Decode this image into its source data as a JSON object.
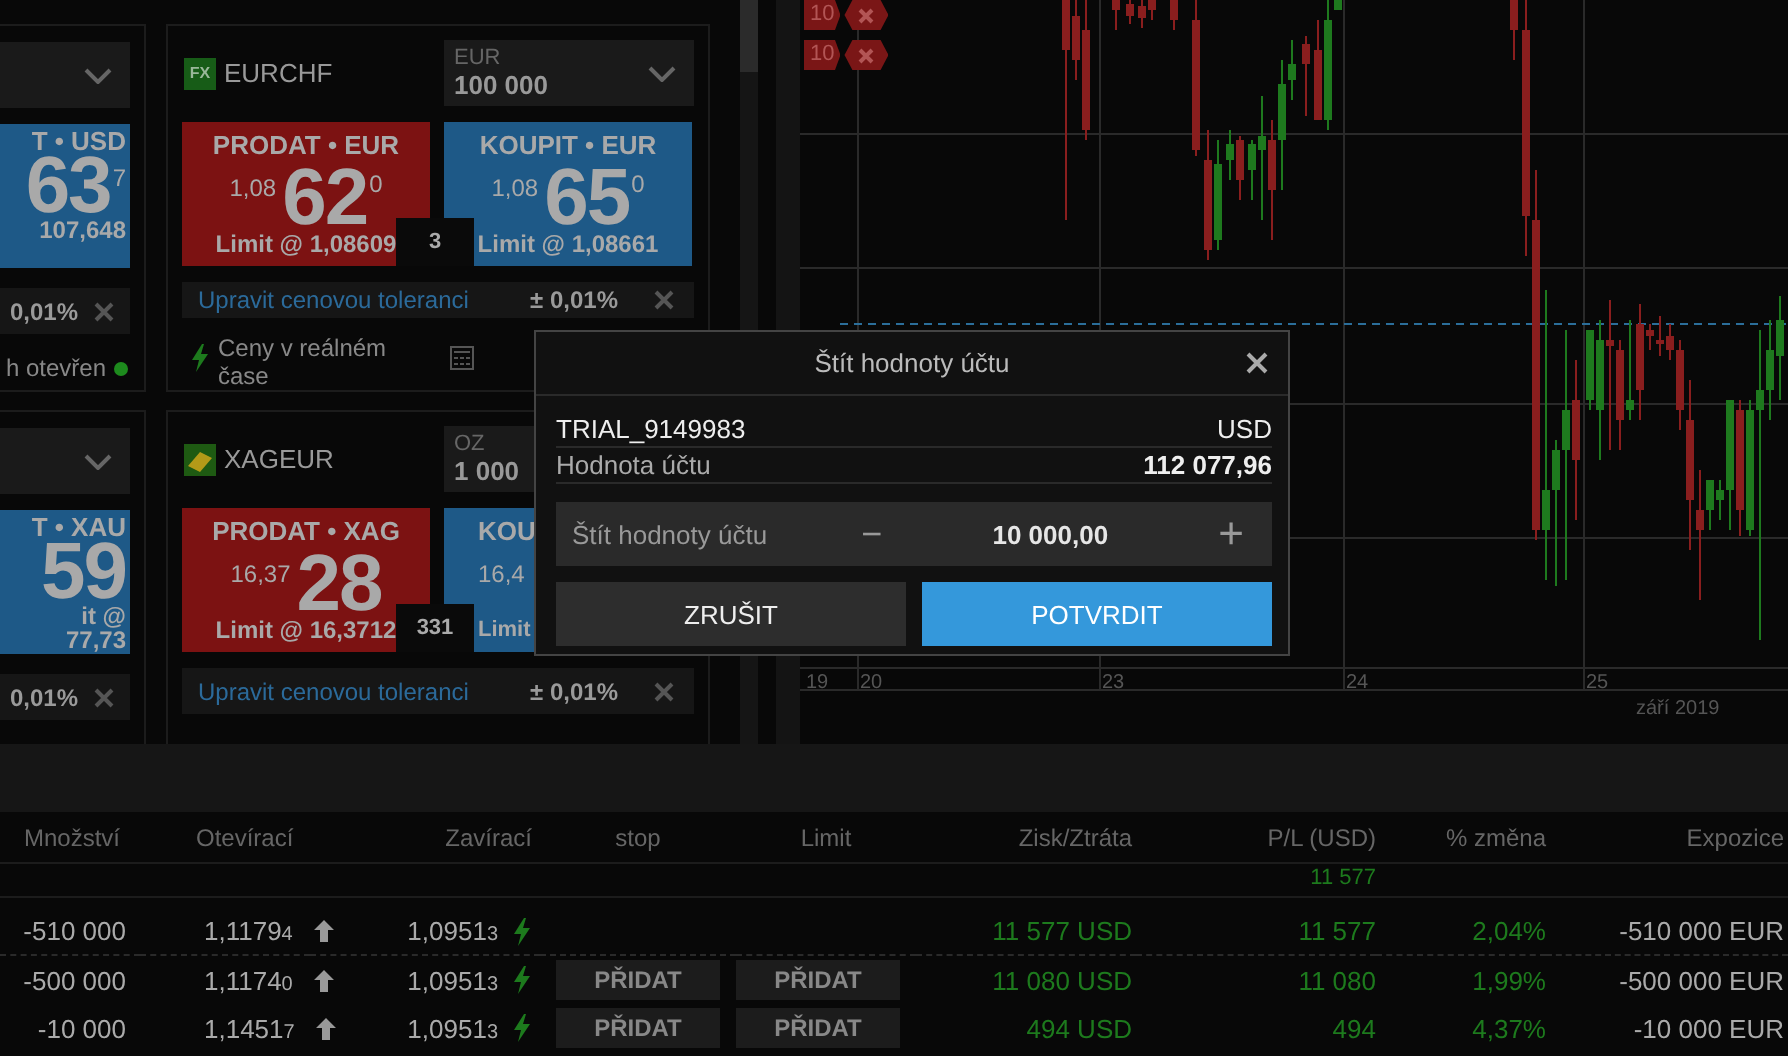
{
  "tile_rows": [
    {
      "partial": {
        "buy": {
          "label": "T • USD",
          "big": "63",
          "sup": "7",
          "limit_lines": [
            "107,648"
          ]
        },
        "tolerance": "0,01%",
        "status": {
          "text": "h otevřen",
          "open": true
        }
      },
      "full": {
        "symbol": "EURCHF",
        "badge": {
          "kind": "fx",
          "text": "FX"
        },
        "unit": "EUR",
        "amount": "100 000",
        "clipped": false,
        "sell": {
          "label": "PRODAT • EUR",
          "small": "1,08",
          "big": "62",
          "sup": "0",
          "limit": "Limit @ 1,08609"
        },
        "spread": "3",
        "buy": {
          "label": "KOUPIT • EUR",
          "small": "1,08",
          "big": "65",
          "sup": "0",
          "limit": "Limit @ 1,08661"
        },
        "tolerance_link": "Upravit cenovou toleranci",
        "tolerance": "± 0,01%",
        "footer": "Ceny v reálném čase"
      }
    },
    {
      "partial": {
        "buy": {
          "label": "T • XAU",
          "big": "59",
          "limit_lines": [
            "it @",
            "77,73"
          ]
        },
        "tolerance": "0,01%"
      },
      "full": {
        "symbol": "XAGEUR",
        "badge": {
          "kind": "metal"
        },
        "unit": "OZ",
        "amount": "1 000",
        "clipped": true,
        "sell": {
          "label": "PRODAT • XAG",
          "small": "16,37",
          "big": "28",
          "limit": "Limit @ 16,3712"
        },
        "spread": "331",
        "buy": {
          "label": "KOU",
          "small": "16,4",
          "limit": "Limit"
        },
        "tolerance_link": "Upravit cenovou toleranci",
        "tolerance": "± 0,01%"
      }
    }
  ],
  "chart": {
    "markers": [
      {
        "text": "10"
      },
      {
        "text": "10"
      }
    ],
    "axis_labels": [
      "19",
      "20",
      "23",
      "24",
      "25"
    ],
    "month": "září 2019"
  },
  "dialog": {
    "title": "Štít hodnoty účtu",
    "account": "TRIAL_9149983",
    "currency": "USD",
    "value_label": "Hodnota účtu",
    "value": "112 077,96",
    "field_label": "Štít hodnoty účtu",
    "decrement": "−",
    "field_value": "10 000,00",
    "increment": "+",
    "buttons": [
      {
        "label": "ZRUŠIT",
        "kind": "secondary"
      },
      {
        "label": "POTVRDIT",
        "kind": "primary"
      }
    ]
  },
  "table": {
    "columns": [
      "Množství",
      "Otevírací",
      "Zavírací",
      "stop",
      "Limit",
      "Zisk/Ztráta",
      "P/L (USD)",
      "% změna",
      "Expozice"
    ],
    "summary": {
      "pl": "11 577"
    },
    "rows": [
      {
        "qty": "-510 000",
        "open": "1,1179",
        "open_pip": "4",
        "close": "1,0951",
        "close_pip": "3",
        "separator": true,
        "profit": "11 577 USD",
        "pl": "11 577",
        "change": "2,04%",
        "exposure": "-510 000 EUR"
      },
      {
        "qty": "-500 000",
        "open": "1,1174",
        "open_pip": "0",
        "close": "1,0951",
        "close_pip": "3",
        "stop": "PŘIDAT",
        "limit": "PŘIDAT",
        "separator": false,
        "profit": "11 080 USD",
        "pl": "11 080",
        "change": "1,99%",
        "exposure": "-500 000 EUR"
      },
      {
        "qty": "-10 000",
        "open": "1,1451",
        "open_pip": "7",
        "close": "1,0951",
        "close_pip": "3",
        "stop": "PŘIDAT",
        "limit": "PŘIDAT",
        "separator": false,
        "profit": "494 USD",
        "pl": "494",
        "change": "4,37%",
        "exposure": "-10 000 EUR"
      }
    ]
  }
}
